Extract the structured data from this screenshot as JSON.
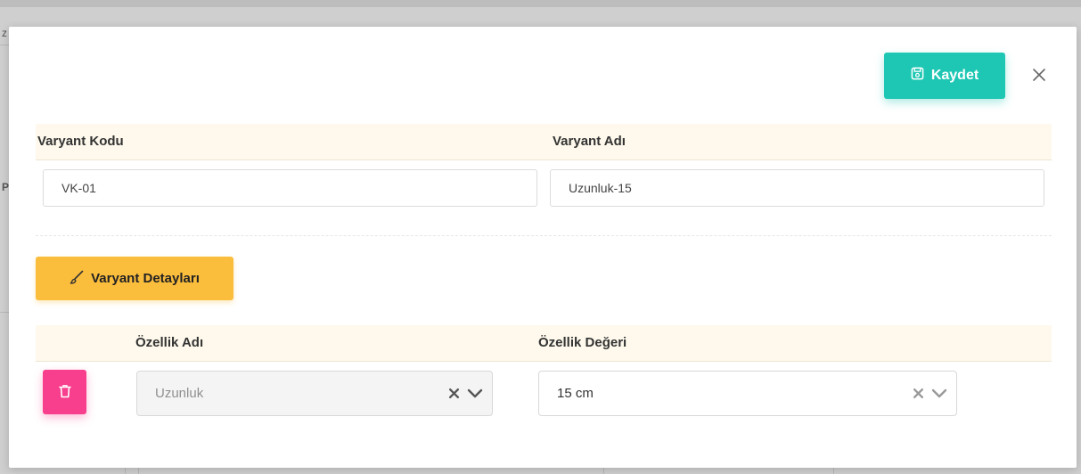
{
  "background": {
    "left_fragment_1": "z",
    "left_fragment_2": "P"
  },
  "modal": {
    "save_label": "Kaydet",
    "close_icon": "close-icon",
    "variant": {
      "code_label": "Varyant Kodu",
      "name_label": "Varyant Adı",
      "code_value": "VK-01",
      "name_value": "Uzunluk-15"
    },
    "details_button_label": "Varyant Detayları",
    "properties": {
      "name_header": "Özellik Adı",
      "value_header": "Özellik Değeri",
      "rows": [
        {
          "name": "Uzunluk",
          "value": "15 cm"
        }
      ]
    }
  },
  "colors": {
    "save": "#1ec7b3",
    "details": "#fbbd3c",
    "delete": "#f83f8d",
    "header_band": "#fef9ec"
  }
}
